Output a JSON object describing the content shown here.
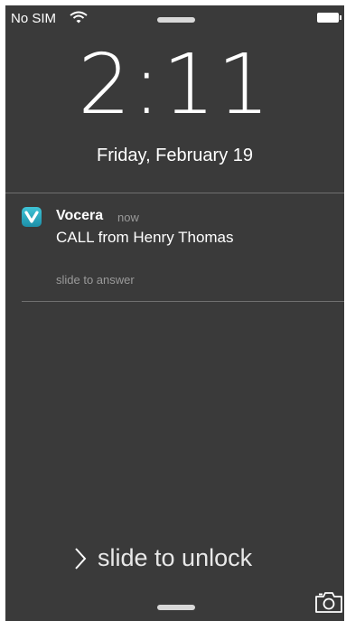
{
  "status_bar": {
    "carrier": "No SIM"
  },
  "clock": {
    "time": "2:11",
    "date": "Friday, February 19"
  },
  "notification": {
    "app_name": "Vocera",
    "time_ago": "now",
    "message": "CALL from Henry Thomas",
    "action_hint": "slide to answer"
  },
  "lock_screen": {
    "unlock_label": "slide to unlock"
  },
  "icons": [
    "wifi-icon",
    "battery-icon",
    "vocera-app-icon",
    "chevron-right-icon",
    "camera-icon"
  ],
  "colors": {
    "background": "#3a3a3a",
    "app_icon": "#2aa9c0",
    "secondary_text": "#9a9a9a"
  }
}
